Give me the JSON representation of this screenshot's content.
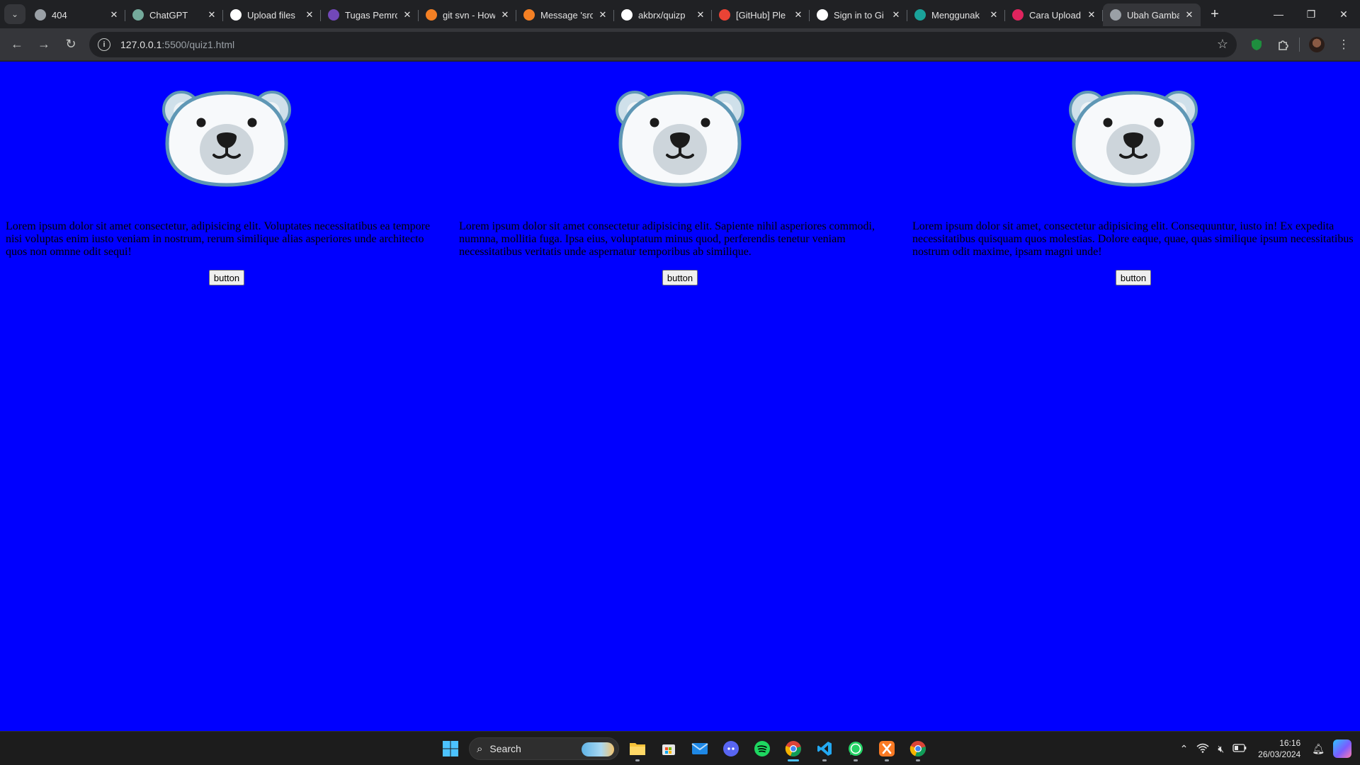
{
  "browser": {
    "tabs": [
      {
        "title": "404",
        "favicon": "globe-icon",
        "fav_color": "#9aa0a6",
        "active": false
      },
      {
        "title": "ChatGPT",
        "favicon": "chatgpt-icon",
        "fav_color": "#74aa9c",
        "active": false
      },
      {
        "title": "Upload files",
        "favicon": "github-icon",
        "fav_color": "#ffffff",
        "active": false
      },
      {
        "title": "Tugas Pemro",
        "favicon": "forms-icon",
        "fav_color": "#7248b9",
        "active": false
      },
      {
        "title": "git svn - How",
        "favicon": "stackoverflow-icon",
        "fav_color": "#f48024",
        "active": false
      },
      {
        "title": "Message 'src",
        "favicon": "stackoverflow-icon",
        "fav_color": "#f48024",
        "active": false
      },
      {
        "title": "akbrx/quizp",
        "favicon": "github-icon",
        "fav_color": "#ffffff",
        "active": false
      },
      {
        "title": "[GitHub] Ple",
        "favicon": "gmail-icon",
        "fav_color": "#ea4335",
        "active": false
      },
      {
        "title": "Sign in to Gi",
        "favicon": "github-icon",
        "fav_color": "#ffffff",
        "active": false
      },
      {
        "title": "Menggunak",
        "favicon": "app-icon",
        "fav_color": "#1aa39a",
        "active": false
      },
      {
        "title": "Cara Upload",
        "favicon": "magnet-icon",
        "fav_color": "#e0245e",
        "active": false
      },
      {
        "title": "Ubah Gamba",
        "favicon": "globe-icon",
        "fav_color": "#9aa0a6",
        "active": true
      }
    ],
    "url_host": "127.0.0.1",
    "url_path": ":5500/quiz1.html"
  },
  "page": {
    "background": "#0000ff",
    "cards": [
      {
        "image": "polar-bear-face",
        "text": "Lorem ipsum dolor sit amet consectetur, adipisicing elit. Voluptates necessitatibus ea tempore nisi voluptas enim iusto veniam in nostrum, rerum similique alias asperiores unde architecto quos non omnne odit sequi!",
        "button": "button"
      },
      {
        "image": "polar-bear-face",
        "text": "Lorem ipsum dolor sit amet consectetur adipisicing elit. Sapiente nihil asperiores commodi, numnna, mollitia fuga. Ipsa eius, voluptatum minus quod, perferendis tenetur veniam necessitatibus veritatis unde aspernatur temporibus ab similique.",
        "button": "button"
      },
      {
        "image": "polar-bear-face",
        "text": "Lorem ipsum dolor sit amet, consectetur adipisicing elit. Consequuntur, iusto in! Ex expedita necessitatibus quisquam quos molestias. Dolore eaque, quae, quas similique ipsum necessitatibus nostrum odit maxime, ipsam magni unde!",
        "button": "button"
      }
    ]
  },
  "taskbar": {
    "search_label": "Search",
    "apps": [
      "file-explorer-icon",
      "microsoft-store-icon",
      "mail-icon",
      "discord-icon",
      "spotify-icon",
      "chrome-icon",
      "vscode-icon",
      "whatsapp-icon",
      "xampp-icon",
      "chrome-icon"
    ],
    "time": "16:16",
    "date": "26/03/2024"
  }
}
